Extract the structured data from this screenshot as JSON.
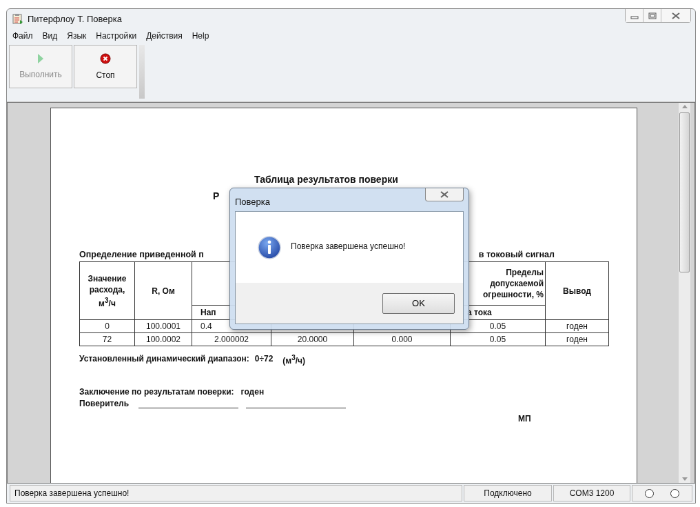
{
  "window": {
    "title": "Питерфлоу Т. Поверка"
  },
  "menu": [
    "Файл",
    "Вид",
    "Язык",
    "Настройки",
    "Действия",
    "Help"
  ],
  "toolbar": [
    {
      "label": "Выполнить",
      "kind": "run",
      "disabled": true
    },
    {
      "label": "Стоп",
      "kind": "stop",
      "disabled": false
    }
  ],
  "document": {
    "title": "Таблица результатов поверки",
    "subtitle_fragments": [
      "Р"
    ],
    "section_fragments": [
      "Определение приведенной п",
      "в токовый сигнал"
    ],
    "table": {
      "header": [
        "Значение расхода, м$^{3}$/ч",
        "R, Ом",
        "Пределы\nдопускаемой\nогрешности, %",
        "Вывод"
      ],
      "subheader": [
        "Нап",
        "а тока"
      ],
      "rows": [
        [
          "0",
          "100.0001",
          "0.4",
          null,
          null,
          "0.05",
          "годен"
        ],
        [
          "72",
          "100.0002",
          "2.000002",
          "20.0000",
          "0.000",
          "0.05",
          "годен"
        ]
      ]
    },
    "range_label": "Установленный динамический диапазон:",
    "range_value": "0÷72",
    "range_unit": "(м$^{3}$/ч)",
    "conclusion_label": "Заключение по результатам поверки:",
    "conclusion_value": "годен",
    "verifier_label": "Поверитель",
    "stamp": "МП"
  },
  "dialog": {
    "title": "Поверка",
    "message": "Поверка завершена успешно!",
    "button": "OK"
  },
  "status_bar": {
    "message": "Поверка завершена успешно!",
    "connection": "Подключено",
    "port": "COM3 1200"
  }
}
